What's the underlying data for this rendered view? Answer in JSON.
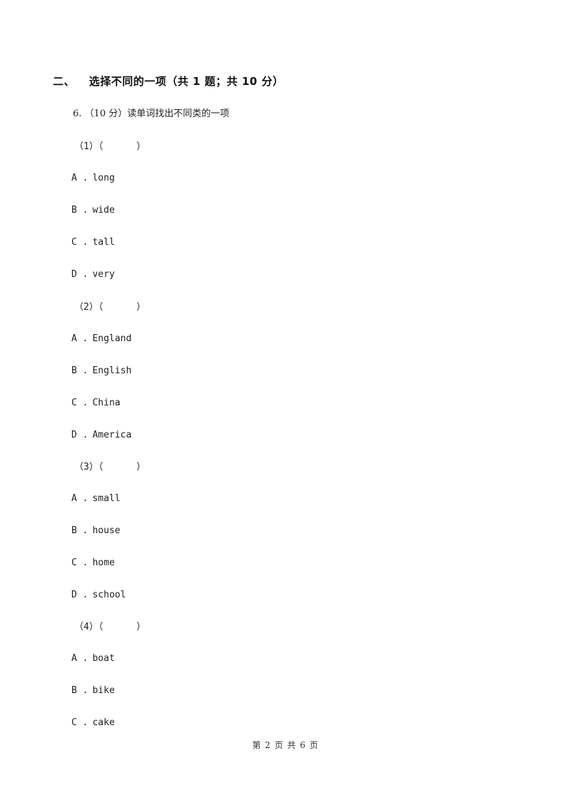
{
  "section": {
    "number": "二、",
    "title": "选择不同的一项（共 1 题；共 10 分）"
  },
  "question": {
    "number": "6.",
    "text": "（10 分）读单词找出不同类的一项",
    "subquestions": [
      {
        "label": "（1）（      ）",
        "options": [
          {
            "letter": "A .",
            "text": "long"
          },
          {
            "letter": "B .",
            "text": "wide"
          },
          {
            "letter": "C .",
            "text": "tall"
          },
          {
            "letter": "D .",
            "text": "very"
          }
        ]
      },
      {
        "label": "（2）（      ）",
        "options": [
          {
            "letter": "A .",
            "text": "England"
          },
          {
            "letter": "B .",
            "text": "English"
          },
          {
            "letter": "C .",
            "text": "China"
          },
          {
            "letter": "D .",
            "text": "America"
          }
        ]
      },
      {
        "label": "（3）（      ）",
        "options": [
          {
            "letter": "A .",
            "text": "small"
          },
          {
            "letter": "B .",
            "text": "house"
          },
          {
            "letter": "C .",
            "text": "home"
          },
          {
            "letter": "D .",
            "text": "school"
          }
        ]
      },
      {
        "label": "（4）（      ）",
        "options": [
          {
            "letter": "A .",
            "text": "boat"
          },
          {
            "letter": "B .",
            "text": "bike"
          },
          {
            "letter": "C .",
            "text": "cake"
          }
        ]
      }
    ]
  },
  "footer": {
    "text": "第 2 页 共 6 页"
  }
}
